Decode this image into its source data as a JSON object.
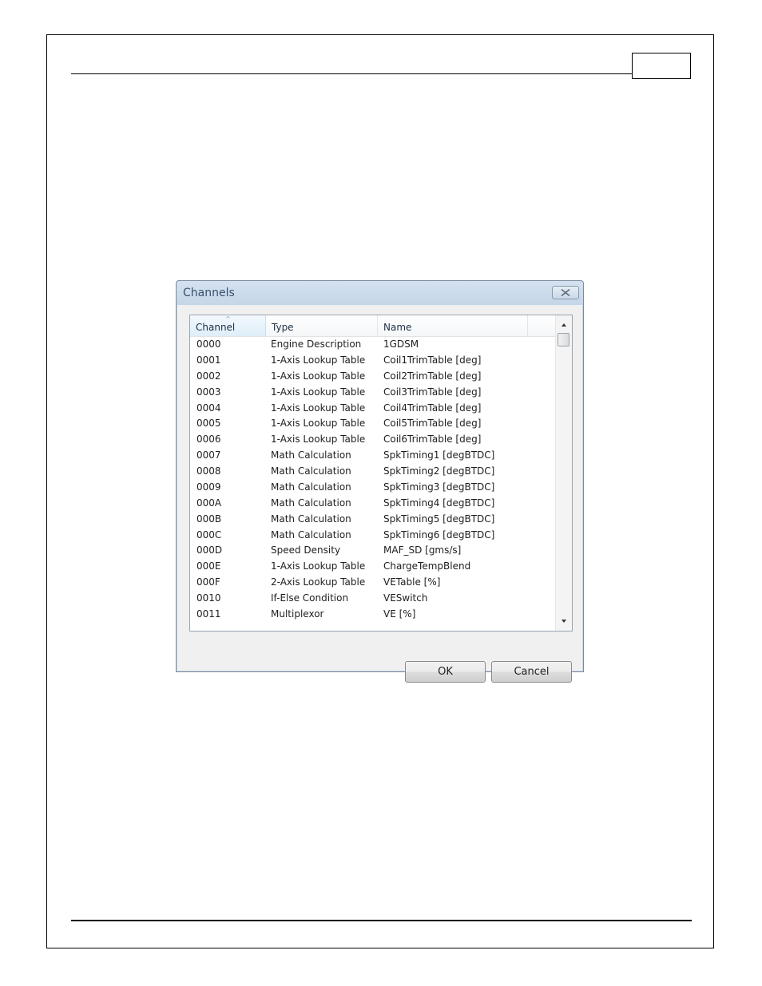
{
  "page": {
    "page_number": ""
  },
  "dialog": {
    "title": "Channels",
    "columns": [
      "Channel",
      "Type",
      "Name"
    ],
    "rows": [
      [
        "0000",
        "Engine Description",
        "1GDSM"
      ],
      [
        "0001",
        "1-Axis Lookup Table",
        "Coil1TrimTable [deg]"
      ],
      [
        "0002",
        "1-Axis Lookup Table",
        "Coil2TrimTable [deg]"
      ],
      [
        "0003",
        "1-Axis Lookup Table",
        "Coil3TrimTable [deg]"
      ],
      [
        "0004",
        "1-Axis Lookup Table",
        "Coil4TrimTable [deg]"
      ],
      [
        "0005",
        "1-Axis Lookup Table",
        "Coil5TrimTable [deg]"
      ],
      [
        "0006",
        "1-Axis Lookup Table",
        "Coil6TrimTable [deg]"
      ],
      [
        "0007",
        "Math Calculation",
        "SpkTiming1 [degBTDC]"
      ],
      [
        "0008",
        "Math Calculation",
        "SpkTiming2 [degBTDC]"
      ],
      [
        "0009",
        "Math Calculation",
        "SpkTiming3 [degBTDC]"
      ],
      [
        "000A",
        "Math Calculation",
        "SpkTiming4 [degBTDC]"
      ],
      [
        "000B",
        "Math Calculation",
        "SpkTiming5 [degBTDC]"
      ],
      [
        "000C",
        "Math Calculation",
        "SpkTiming6 [degBTDC]"
      ],
      [
        "000D",
        "Speed Density",
        "MAF_SD [gms/s]"
      ],
      [
        "000E",
        "1-Axis Lookup Table",
        "ChargeTempBlend"
      ],
      [
        "000F",
        "2-Axis Lookup Table",
        "VETable [%]"
      ],
      [
        "0010",
        "If-Else Condition",
        "VESwitch"
      ],
      [
        "0011",
        "Multiplexor",
        "VE [%]"
      ]
    ],
    "ok_label": "OK",
    "cancel_label": "Cancel"
  },
  "icons": {
    "close": "close-icon",
    "sort": "sort-ascending-icon",
    "scroll_up": "scroll-up-arrow-icon",
    "scroll_down": "scroll-down-arrow-icon"
  }
}
